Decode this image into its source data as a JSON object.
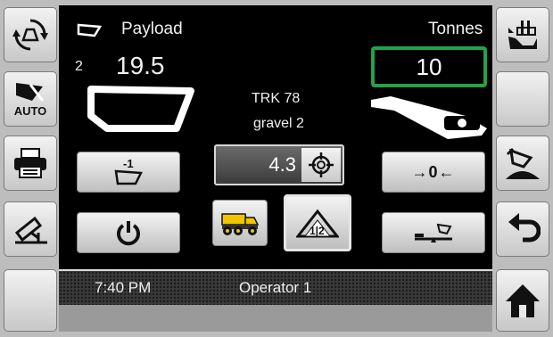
{
  "payload": {
    "label": "Payload",
    "pass_count": "2",
    "value": "19.5"
  },
  "units": {
    "label": "Tonnes",
    "target_value": "10"
  },
  "truck": {
    "id": "TRK 78",
    "material": "gravel 2"
  },
  "measure": {
    "value": "4.3"
  },
  "status": {
    "time": "7:40 PM",
    "operator": "Operator 1"
  },
  "left_buttons": [
    {
      "icon": "recycle-scale-icon"
    },
    {
      "icon": "auto-bucket-icon",
      "label": "AUTO"
    },
    {
      "icon": "printer-icon"
    },
    {
      "icon": "camera-icon"
    },
    {
      "icon": "blank"
    }
  ],
  "right_buttons": [
    {
      "icon": "dump-bucket-icon"
    },
    {
      "icon": "blank"
    },
    {
      "icon": "dump-pile-icon"
    },
    {
      "icon": "undo-icon"
    },
    {
      "icon": "home-icon"
    }
  ],
  "soft_buttons": [
    {
      "icon": "minus-one-bucket-icon",
      "label": "-1"
    },
    {
      "icon": "zero-icon",
      "label": "→0←"
    },
    {
      "icon": "power-icon"
    },
    {
      "icon": "truck-icon"
    },
    {
      "icon": "split-pile-icon",
      "label": "1|2"
    },
    {
      "icon": "tilt-calibrate-icon"
    }
  ],
  "colors": {
    "accent_green": "#23a24a",
    "truck_yellow": "#f0c400"
  }
}
